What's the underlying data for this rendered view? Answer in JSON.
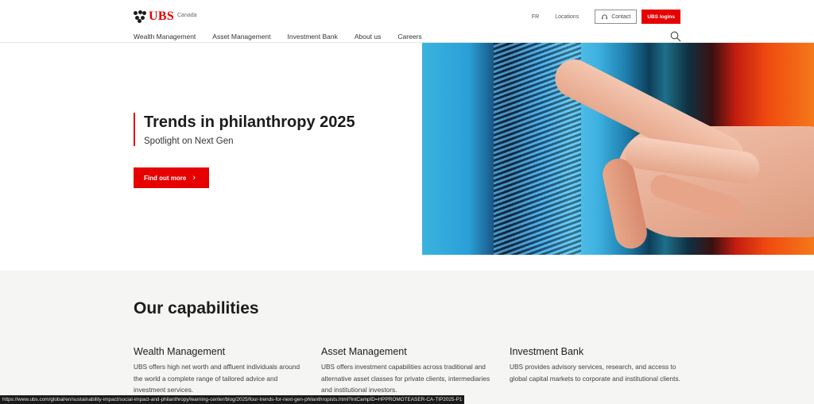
{
  "header": {
    "brand": "UBS",
    "region": "Canada",
    "top_links": [
      "FR",
      "Locations"
    ],
    "contact_label": "Contact",
    "login_label": "UBS logins",
    "nav": [
      "Wealth Management",
      "Asset Management",
      "Investment Bank",
      "About us",
      "Careers"
    ],
    "icons": {
      "search": "search-icon",
      "contact": "headset-icon",
      "logo": "three-keys-icon"
    }
  },
  "hero": {
    "title": "Trends in philanthropy 2025",
    "subtitle": "Spotlight on Next Gen",
    "cta_label": "Find out more",
    "cta_icon": "chevron-right-icon",
    "image_alt": "Hand touching a colorful digital screen"
  },
  "capabilities": {
    "title": "Our capabilities",
    "items": [
      {
        "heading": "Wealth Management",
        "text": "UBS offers high net worth and affluent individuals around the world a complete range of tailored advice and investment services."
      },
      {
        "heading": "Asset Management",
        "text": "UBS offers investment capabilities across traditional and alternative asset classes for private clients, intermediaries and institutional investors."
      },
      {
        "heading": "Investment Bank",
        "text": "UBS provides advisory services, research, and access to global capital markets to corporate and institutional clients."
      }
    ]
  },
  "status_url": "https://www.ubs.com/global/en/sustainability-impact/social-impact-and-philanthropy/learning-center/blog/2025/four-trends-for-next-gen-philanthropists.html?intCampID=HPPROMOTEASER-CA-TIP2025-P1",
  "colors": {
    "brand_red": "#e60000",
    "text": "#1c1c1c",
    "section_bg": "#f5f5f3"
  }
}
